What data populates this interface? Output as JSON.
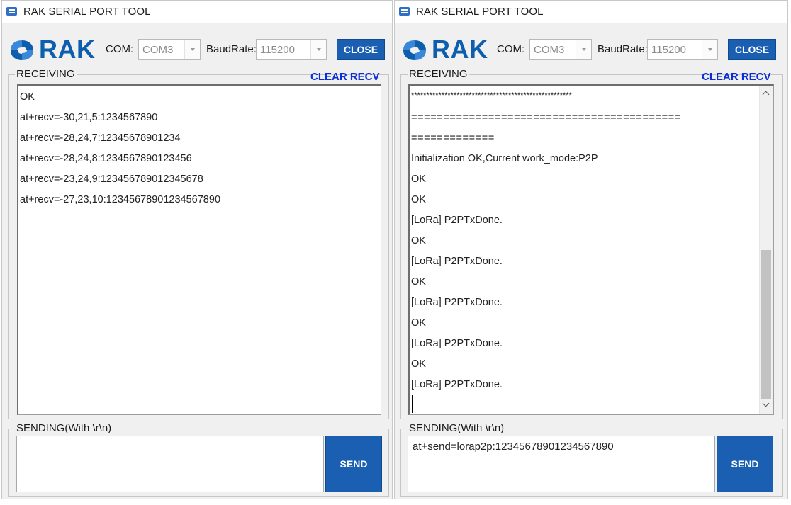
{
  "windows": [
    {
      "title": "RAK SERIAL PORT TOOL",
      "logo_text": "RAK",
      "com_label": "COM:",
      "com_value": "COM3",
      "baud_label": "BaudRate:",
      "baud_value": "115200",
      "close_label": "CLOSE",
      "receiving_label": "RECEIVING",
      "clear_label": "CLEAR RECV",
      "sending_label": "SENDING(With \\r\\n)",
      "send_label": "SEND",
      "send_input": "",
      "recv_lines": [
        "OK",
        "at+recv=-30,21,5:1234567890",
        "at+recv=-28,24,7:12345678901234",
        "at+recv=-28,24,8:1234567890123456",
        "at+recv=-23,24,9:123456789012345678",
        "at+recv=-27,23,10:12345678901234567890"
      ]
    },
    {
      "title": "RAK SERIAL PORT TOOL",
      "logo_text": "RAK",
      "com_label": "COM:",
      "com_value": "COM3",
      "baud_label": "BaudRate:",
      "baud_value": "115200",
      "close_label": "CLOSE",
      "receiving_label": "RECEIVING",
      "clear_label": "CLEAR RECV",
      "sending_label": "SENDING(With \\r\\n)",
      "send_label": "SEND",
      "send_input": "at+send=lorap2p:12345678901234567890",
      "recv_lines": [
        "*****************************************************",
        "==========================================",
        "=============",
        "Initialization OK,Current work_mode:P2P",
        "OK",
        "OK",
        "[LoRa] P2PTxDone.",
        "OK",
        "[LoRa] P2PTxDone.",
        "OK",
        "[LoRa] P2PTxDone.",
        "OK",
        "[LoRa] P2PTxDone.",
        "OK",
        "[LoRa] P2PTxDone."
      ]
    }
  ],
  "colors": {
    "accent": "#1a5fb2",
    "logo": "#0d5fae",
    "link": "#0a2fd8"
  },
  "icons": {
    "title": "serial-port-app-icon",
    "logo": "rak-logo-mark",
    "dropdown": "chevron-down-icon",
    "scroll_up": "scroll-up-arrow-icon",
    "scroll_down": "scroll-down-arrow-icon"
  }
}
